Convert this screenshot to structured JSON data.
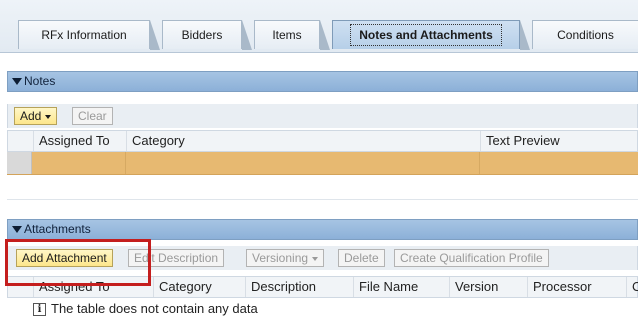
{
  "tabs": [
    {
      "label": "RFx Information",
      "active": false
    },
    {
      "label": "Bidders",
      "active": false
    },
    {
      "label": "Items",
      "active": false
    },
    {
      "label": "Notes and Attachments",
      "active": true
    },
    {
      "label": "Conditions",
      "active": false
    }
  ],
  "notes": {
    "header": "Notes",
    "toolbar": {
      "add_label": "Add",
      "clear_label": "Clear"
    },
    "columns": [
      "Assigned To",
      "Category",
      "Text Preview"
    ]
  },
  "attachments": {
    "header": "Attachments",
    "toolbar": {
      "add_attachment_label": "Add Attachment",
      "edit_description_label": "Edit Description",
      "versioning_label": "Versioning",
      "delete_label": "Delete",
      "create_profile_label": "Create Qualification Profile"
    },
    "columns": [
      "Assigned To",
      "Category",
      "Description",
      "File Name",
      "Version",
      "Processor",
      "C"
    ],
    "empty_message": "The table does not contain any data"
  },
  "colors": {
    "highlight_box": "#c41e1e",
    "selected_row": "#e7b971",
    "section_header": "#a6c4e3"
  }
}
